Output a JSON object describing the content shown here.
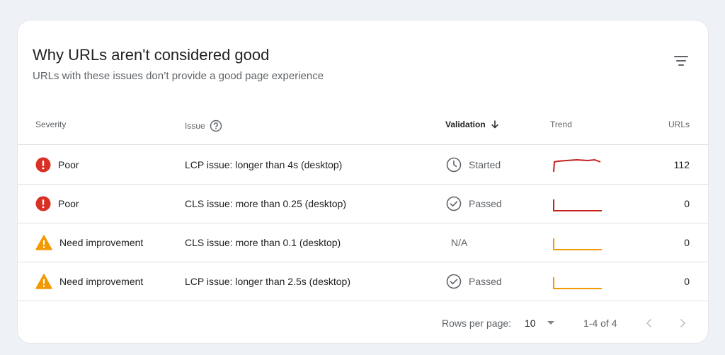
{
  "card": {
    "title": "Why URLs aren't considered good",
    "subtitle": "URLs with these issues don’t provide a good page experience"
  },
  "columns": {
    "severity": "Severity",
    "issue": "Issue",
    "validation": "Validation",
    "trend": "Trend",
    "urls": "URLs"
  },
  "rows": [
    {
      "severity": "Poor",
      "severity_level": "poor",
      "issue": "LCP issue: longer than 4s (desktop)",
      "validation": "Started",
      "validation_icon": "clock-icon",
      "urls": "112",
      "trend_color": "#c5221f"
    },
    {
      "severity": "Poor",
      "severity_level": "poor",
      "issue": "CLS issue: more than 0.25 (desktop)",
      "validation": "Passed",
      "validation_icon": "check-circle-icon",
      "urls": "0",
      "trend_color": "#c5221f"
    },
    {
      "severity": "Need improvement",
      "severity_level": "warning",
      "issue": "CLS issue: more than 0.1 (desktop)",
      "validation": "N/A",
      "validation_icon": "",
      "urls": "0",
      "trend_color": "#f29900"
    },
    {
      "severity": "Need improvement",
      "severity_level": "warning",
      "issue": "LCP issue: longer than 2.5s (desktop)",
      "validation": "Passed",
      "validation_icon": "check-circle-icon",
      "urls": "0",
      "trend_color": "#f29900"
    }
  ],
  "pagination": {
    "rows_per_page_label": "Rows per page:",
    "rows_per_page_value": "10",
    "range": "1-4 of 4"
  },
  "colors": {
    "poor": "#d93025",
    "warning": "#f29900",
    "background": "#eef1f6"
  }
}
